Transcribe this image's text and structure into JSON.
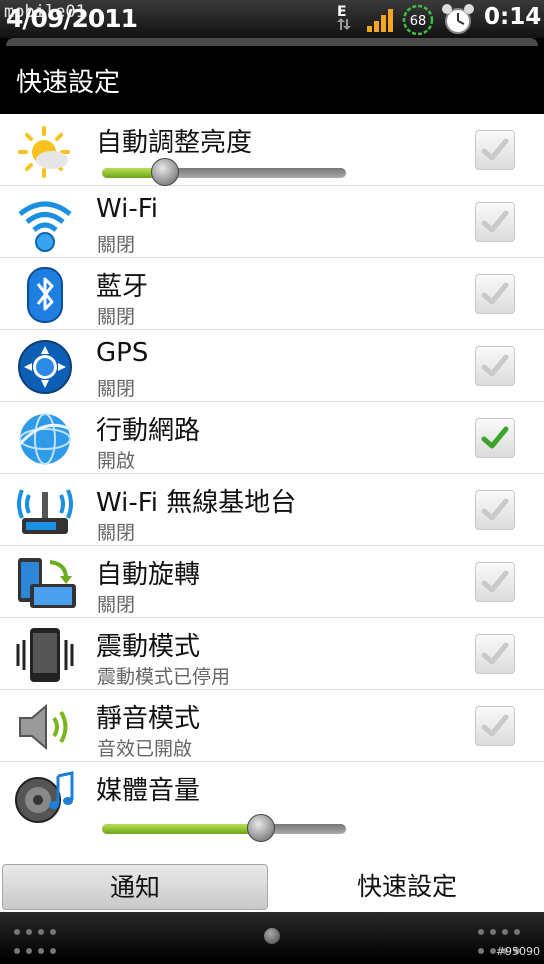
{
  "status_bar": {
    "date": "4/09/2011",
    "watermark": "mobile01",
    "network": "E",
    "battery": "68",
    "time": "0:14"
  },
  "title": "快速設定",
  "rows": [
    {
      "label": "自動調整亮度",
      "icon": "brightness-icon",
      "checked": false,
      "slider_level": 0.26
    },
    {
      "label": "Wi-Fi",
      "status": "關閉",
      "icon": "wifi-icon",
      "checked": false
    },
    {
      "label": "藍牙",
      "status": "關閉",
      "icon": "bluetooth-icon",
      "checked": false
    },
    {
      "label": "GPS",
      "status": "關閉",
      "icon": "gps-icon",
      "checked": false
    },
    {
      "label": "行動網路",
      "status": "開啟",
      "icon": "mobile-network-icon",
      "checked": true
    },
    {
      "label": "Wi-Fi 無線基地台",
      "status": "關閉",
      "icon": "wifi-hotspot-icon",
      "checked": false
    },
    {
      "label": "自動旋轉",
      "status": "關閉",
      "icon": "auto-rotate-icon",
      "checked": false
    },
    {
      "label": "震動模式",
      "status": "震動模式已停用",
      "icon": "vibrate-icon",
      "checked": false
    },
    {
      "label": "靜音模式",
      "status": "音效已開啟",
      "icon": "silent-mode-icon",
      "checked": false
    },
    {
      "label": "媒體音量",
      "icon": "media-volume-icon",
      "slider_level": 0.65
    }
  ],
  "tabs": [
    {
      "label": "通知",
      "active": false
    },
    {
      "label": "快速設定",
      "active": true
    }
  ],
  "footer_watermark": "#95090",
  "colors": {
    "accent_green": "#7ab51d",
    "check_green": "#3aa52a"
  }
}
